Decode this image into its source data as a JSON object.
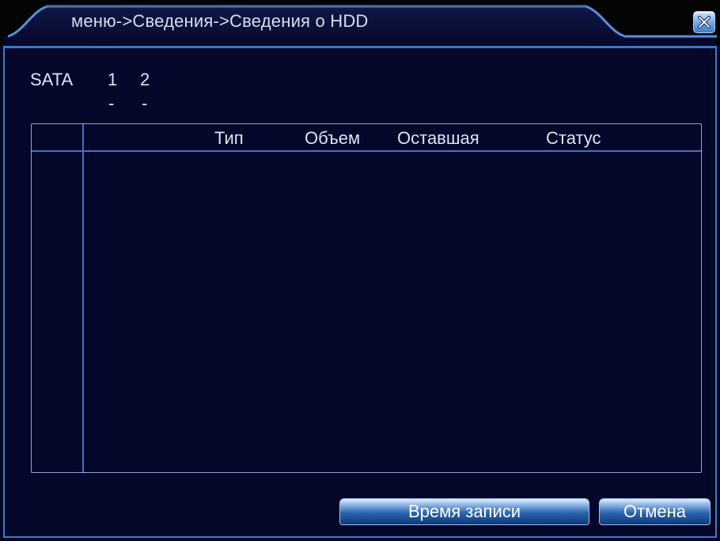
{
  "window": {
    "title": "меню->Сведения->Сведения о HDD"
  },
  "sata": {
    "label": "SATA",
    "ports": [
      {
        "number": "1",
        "status": "-"
      },
      {
        "number": "2",
        "status": "-"
      }
    ]
  },
  "table": {
    "columns": [
      "",
      "Тип",
      "Объем",
      "Оставшая",
      "Статус"
    ],
    "rows": []
  },
  "buttons": {
    "record_time": "Время записи",
    "cancel": "Отмена"
  },
  "colors": {
    "background": "#04062a",
    "accent": "#3f73c6",
    "text": "#dfe3f2"
  }
}
